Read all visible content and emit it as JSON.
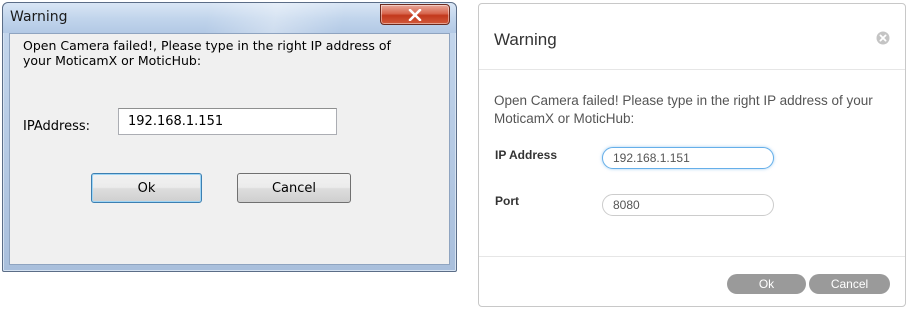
{
  "classic_dialog": {
    "title": "Warning",
    "message": "Open Camera failed!, Please type in the right IP address of your MoticamX or MoticHub:",
    "ip_label": "IPAddress:",
    "ip_value": "192.168.1.151",
    "ok_label": "Ok",
    "cancel_label": "Cancel",
    "close_icon": "close-icon",
    "close_color": "#c7402a"
  },
  "modern_dialog": {
    "title": "Warning",
    "message": "Open Camera failed! Please type in the right IP address of your MoticamX or MoticHub:",
    "ip_label": "IP Address",
    "ip_value": "192.168.1.151",
    "port_label": "Port",
    "port_value": "8080",
    "ok_label": "Ok",
    "cancel_label": "Cancel",
    "close_icon": "circle-x-icon",
    "button_color": "#9a9a9a",
    "focus_color": "#66afe9"
  }
}
